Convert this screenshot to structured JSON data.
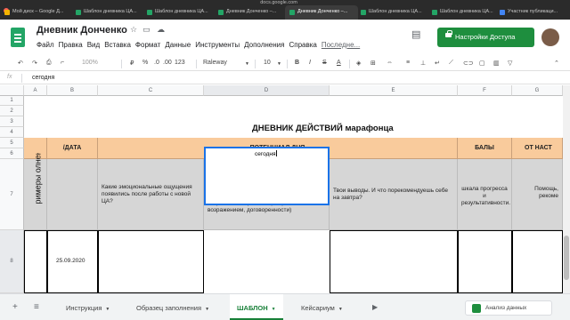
{
  "browser": {
    "url": "docs.google.com",
    "tabs": [
      {
        "label": "Мой диск – Google Д..."
      },
      {
        "label": "Шаблон дневника ЦА..."
      },
      {
        "label": "Шаблон дневника ЦА..."
      },
      {
        "label": "Дневник Донченко –..."
      },
      {
        "label": "Дневник Донченко –..."
      },
      {
        "label": "Шаблон дневника ЦА..."
      },
      {
        "label": "Шаблон дневника ЦА..."
      },
      {
        "label": "Участник публикаци..."
      }
    ]
  },
  "header": {
    "title": "Дневник Донченко",
    "menu": [
      "Файл",
      "Правка",
      "Вид",
      "Вставка",
      "Формат",
      "Данные",
      "Инструменты",
      "Дополнения",
      "Справка"
    ],
    "last_edit": "Последне...",
    "share_label": "Настройки Доступа"
  },
  "toolbar": {
    "zoom": "100%",
    "currency": "₽",
    "percent": "%",
    "decimal_less": ".0",
    "decimal_more": ".00",
    "number_format": "123",
    "font": "Raleway",
    "font_size": "10",
    "bold": "B",
    "italic": "I",
    "strike": "S",
    "text_color": "A"
  },
  "formula_bar": {
    "fx": "fx",
    "value": "сегодня"
  },
  "grid": {
    "columns": [
      "A",
      "B",
      "C",
      "D",
      "E",
      "F",
      "G"
    ],
    "rows": [
      "1",
      "2",
      "3",
      "4",
      "5",
      "6",
      "7",
      "8"
    ],
    "title": "ДНЕВНИК ДЕЙСТВИЙ марафонца",
    "header_date": "/ДАТА",
    "header_potential": "ПОТЕНЦИАЛ ДНЯ",
    "header_points": "БАЛЫ",
    "header_from": "ОТ НАСТ",
    "q_emotions": "Какие эмоциональные ощущения появились после работы с новой ЦА?",
    "q_stages": "Какой из 5 этапов встреч удался лучше всего? С каким возникают чаще всего сложности? (Этапы встречи: присоединение, формирование потребности, презентация, работа с возражением, договоренности)",
    "q_conclusions": "Твои выводы. И что порекомендуешь себе на завтра?",
    "q_scale": "шкала прогресса и результативности.",
    "q_help": "Помощь, рекоме",
    "examples_label": "римеры олнения",
    "date_value": "25.09.2020",
    "active_value": "сегодня"
  },
  "sheets": {
    "tabs": [
      {
        "label": "Инструкция"
      },
      {
        "label": "Образец заполнения"
      },
      {
        "label": "ШАБЛОН"
      },
      {
        "label": "Кейсариум"
      }
    ],
    "explore_label": "Анализ данных"
  }
}
